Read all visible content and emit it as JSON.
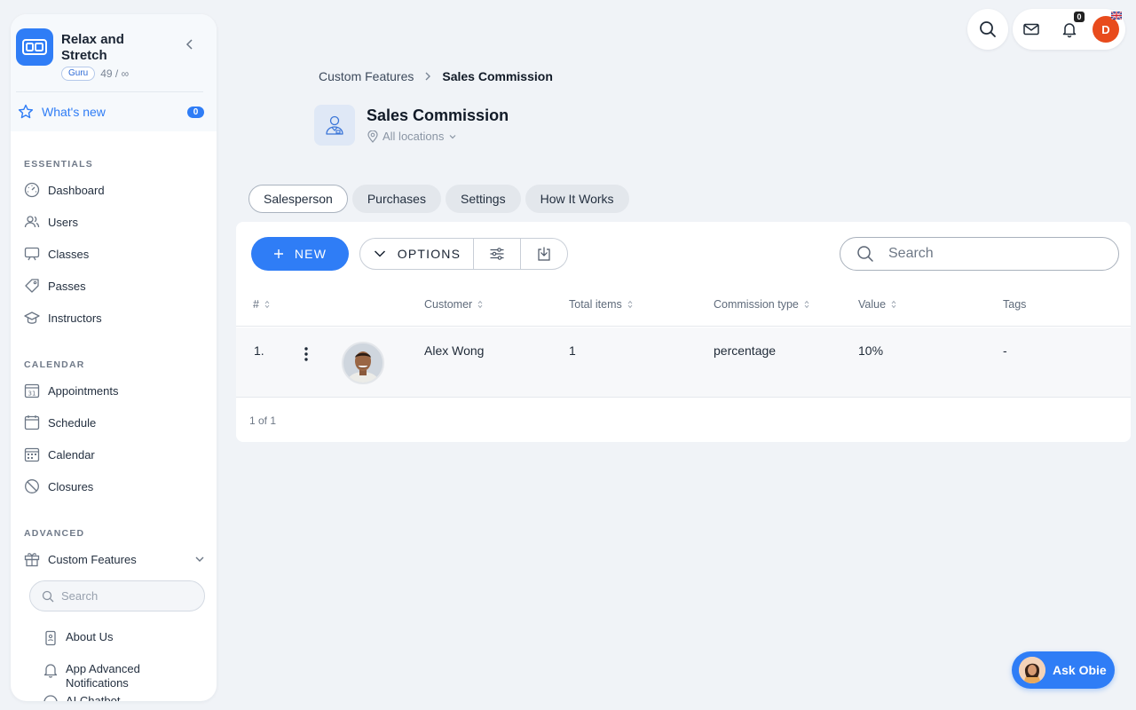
{
  "brand": {
    "name": "Relax and Stretch",
    "plan_badge": "Guru",
    "count": "49 / ∞"
  },
  "whats_new": {
    "label": "What's new",
    "count": "0"
  },
  "sections": {
    "essentials": "ESSENTIALS",
    "calendar": "CALENDAR",
    "advanced": "ADVANCED"
  },
  "nav": {
    "dashboard": "Dashboard",
    "users": "Users",
    "classes": "Classes",
    "passes": "Passes",
    "instructors": "Instructors",
    "appointments": "Appointments",
    "schedule": "Schedule",
    "calendar": "Calendar",
    "closures": "Closures",
    "custom_features": "Custom Features"
  },
  "sidebar_search": {
    "placeholder": "Search"
  },
  "sub_items": {
    "about_us": "About Us",
    "app_advanced_notifications": "App Advanced Notifications",
    "ai_chatbot": "AI Chatbot"
  },
  "topbar": {
    "bell_count": "0",
    "avatar_letter": "D"
  },
  "breadcrumb": {
    "parent": "Custom Features",
    "current": "Sales Commission"
  },
  "page": {
    "title": "Sales Commission",
    "location": "All locations"
  },
  "tabs": [
    "Salesperson",
    "Purchases",
    "Settings",
    "How It Works"
  ],
  "toolbar": {
    "new_label": "NEW",
    "options_label": "OPTIONS",
    "search_placeholder": "Search"
  },
  "table": {
    "columns": [
      "#",
      "Customer",
      "Total items",
      "Commission type",
      "Value",
      "Tags"
    ],
    "rows": [
      {
        "index": "1.",
        "customer": "Alex Wong",
        "total_items": "1",
        "commission_type": "percentage",
        "value": "10%",
        "tags": "-"
      }
    ],
    "pager": "1 of 1"
  },
  "ask_obie": {
    "label": "Ask Obie"
  },
  "colors": {
    "accent": "#2f7df6",
    "avatar": "#e84b1c",
    "background": "#f0f3f7"
  }
}
